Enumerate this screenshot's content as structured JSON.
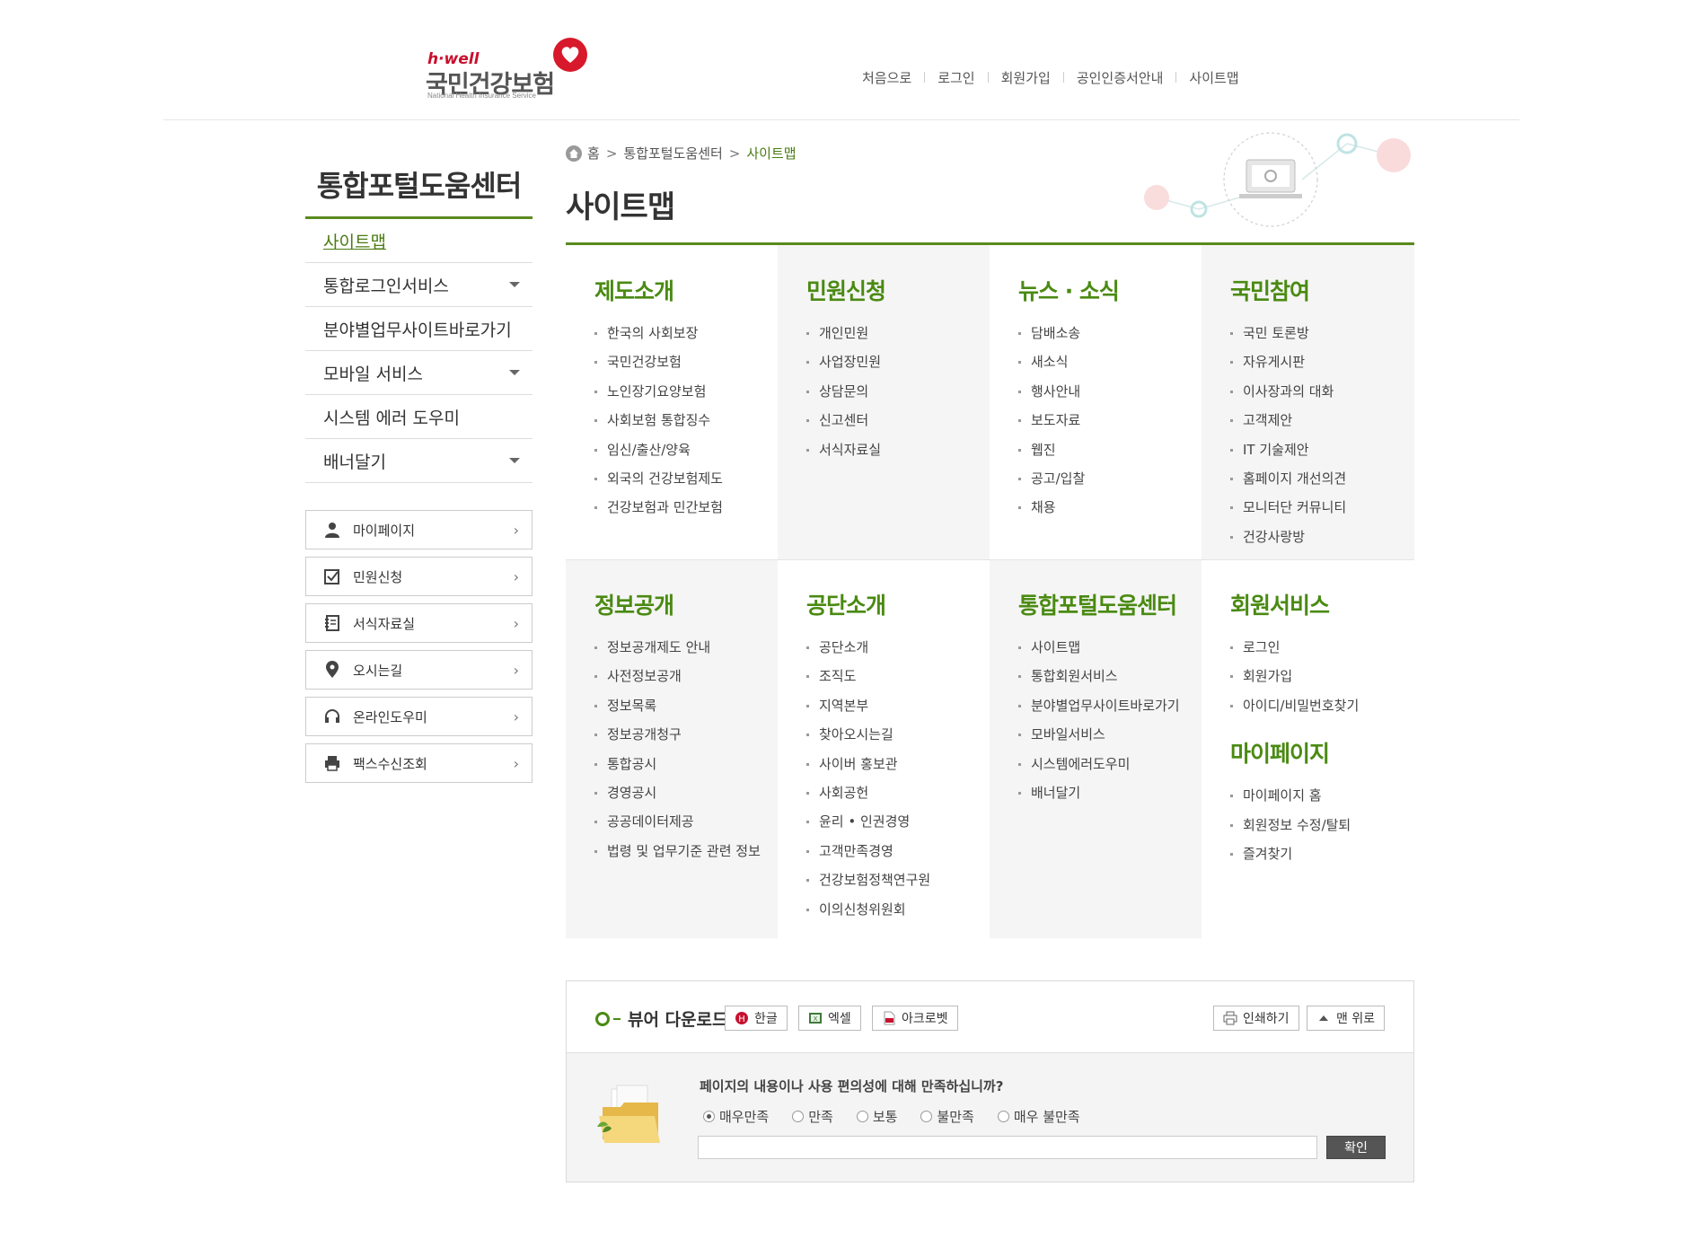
{
  "header": {
    "logo_top": "h·well",
    "logo_name": "국민건강보험",
    "logo_sub": "National Health Insurance Service",
    "nav": [
      "처음으로",
      "로그인",
      "회원가입",
      "공인인증서안내",
      "사이트맵"
    ]
  },
  "sidebar": {
    "title": "통합포털도움센터",
    "items": [
      {
        "label": "사이트맵",
        "active": true,
        "has_dropdown": false
      },
      {
        "label": "통합로그인서비스",
        "active": false,
        "has_dropdown": true
      },
      {
        "label": "분야별업무사이트바로가기",
        "active": false,
        "has_dropdown": false
      },
      {
        "label": "모바일 서비스",
        "active": false,
        "has_dropdown": true
      },
      {
        "label": "시스템 에러 도우미",
        "active": false,
        "has_dropdown": false
      },
      {
        "label": "배너달기",
        "active": false,
        "has_dropdown": true
      }
    ],
    "quick_links": [
      {
        "label": "마이페이지",
        "icon": "person-icon"
      },
      {
        "label": "민원신청",
        "icon": "checkbox-icon"
      },
      {
        "label": "서식자료실",
        "icon": "notebook-icon"
      },
      {
        "label": "오시는길",
        "icon": "location-pin-icon"
      },
      {
        "label": "온라인도우미",
        "icon": "headset-icon"
      },
      {
        "label": "팩스수신조회",
        "icon": "printer-icon"
      }
    ]
  },
  "breadcrumb": {
    "home": "홈",
    "parent": "통합포털도움센터",
    "current": "사이트맵"
  },
  "page_title": "사이트맵",
  "sitemap": {
    "row1": [
      {
        "title": "제도소개",
        "items": [
          "한국의 사회보장",
          "국민건강보험",
          "노인장기요양보험",
          "사회보험 통합징수",
          "임신/출산/양육",
          "외국의 건강보험제도",
          "건강보험과 민간보험"
        ]
      },
      {
        "title": "민원신청",
        "items": [
          "개인민원",
          "사업장민원",
          "상담문의",
          "신고센터",
          "서식자료실"
        ]
      },
      {
        "title": "뉴스 · 소식",
        "items": [
          "담배소송",
          "새소식",
          "행사안내",
          "보도자료",
          "웹진",
          "공고/입찰",
          "채용"
        ]
      },
      {
        "title": "국민참여",
        "items": [
          "국민 토론방",
          "자유게시판",
          "이사장과의 대화",
          "고객제안",
          "IT 기술제안",
          "홈페이지 개선의견",
          "모니터단 커뮤니티",
          "건강사랑방"
        ]
      }
    ],
    "row2": [
      {
        "title": "정보공개",
        "items": [
          "정보공개제도 안내",
          "사전정보공개",
          "정보목록",
          "정보공개청구",
          "통합공시",
          "경영공시",
          "공공데이터제공",
          "법령 및 업무기준 관련 정보"
        ]
      },
      {
        "title": "공단소개",
        "items": [
          "공단소개",
          "조직도",
          "지역본부",
          "찾아오시는길",
          "사이버 홍보관",
          "사회공헌",
          "윤리 • 인권경영",
          "고객만족경영",
          "건강보험정책연구원",
          "이의신청위원회"
        ]
      },
      {
        "title": "통합포털도움센터",
        "items": [
          "사이트맵",
          "통합회원서비스",
          "분야별업무사이트바로가기",
          "모바일서비스",
          "시스템에러도우미",
          "배너달기"
        ]
      },
      {
        "title": "회원서비스",
        "items": [
          "로그인",
          "회원가입",
          "아이디/비밀번호찾기"
        ],
        "title2": "마이페이지",
        "items2": [
          "마이페이지 홈",
          "회원정보 수정/탈퇴",
          "즐겨찾기"
        ]
      }
    ]
  },
  "viewer": {
    "label": "뷰어 다운로드",
    "buttons": [
      "한글",
      "엑셀",
      "아크로벳"
    ],
    "print": "인쇄하기",
    "top": "맨 위로"
  },
  "survey": {
    "question": "페이지의 내용이나 사용 편의성에 대해 만족하십니까?",
    "options": [
      "매우만족",
      "만족",
      "보통",
      "불만족",
      "매우 불만족"
    ],
    "selected": "매우만족",
    "submit": "확인"
  },
  "colors": {
    "accent_green": "#4a8a12",
    "line_green": "#5a8a1e",
    "logo_red": "#c8102e"
  }
}
